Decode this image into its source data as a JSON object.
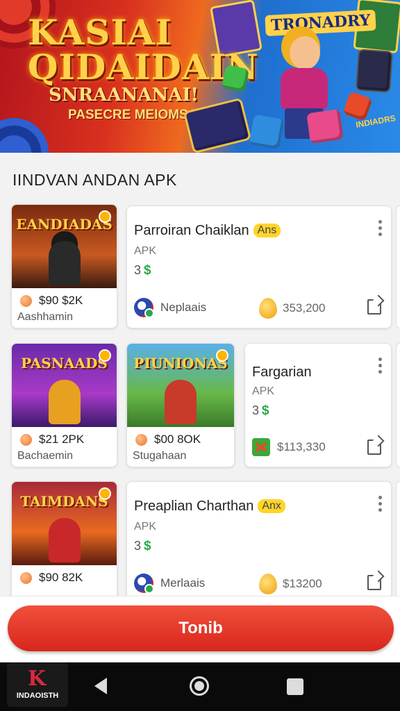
{
  "banner": {
    "title": "KASIAI QIDAIDAIN",
    "subtitle": "SNRAANANAI!",
    "tagline": "PASECRE MEIOMSAI",
    "brand": "TRONADRY",
    "corner_tag": "INDIADRS"
  },
  "section": {
    "title": "IINDVAN ANDAN APK"
  },
  "row1": {
    "small": {
      "thumb_title": "EANDIADAS",
      "price": "$90 $2K",
      "name": "Aashhamin"
    },
    "wide": {
      "title": "Parroiran Chaiklan",
      "badge": "Ans",
      "type": "APK",
      "rating": "3",
      "rating_symbol": "$",
      "developer": "Neplaais",
      "count": "353,200"
    }
  },
  "row2": {
    "small_a": {
      "thumb_title": "PASNAADS",
      "price": "$21 2PK",
      "name": "Bachaemin"
    },
    "small_b": {
      "thumb_title": "PIUNIONAS",
      "price": "$00 8OK",
      "name": "Stugahaan"
    },
    "wide": {
      "title": "Fargarian",
      "type": "APK",
      "rating": "3",
      "rating_symbol": "$",
      "count": "$113,330"
    }
  },
  "row3": {
    "small": {
      "thumb_title": "TAIMDANS",
      "price": "$90 82K"
    },
    "wide": {
      "title": "Preaplian Charthan",
      "badge": "Anx",
      "type": "APK",
      "rating": "3",
      "rating_symbol": "$",
      "developer": "Merlaais",
      "count": "$13200"
    }
  },
  "cta": {
    "label": "Tonib"
  },
  "app": {
    "logo_letter": "K",
    "logo_name": "INDAOISTH"
  },
  "colors": {
    "accent": "#d8261c",
    "badge": "#ffd52a",
    "rating_green": "#2aa84a"
  },
  "icons": [
    "coin-icon",
    "avatar-icon",
    "droplet-icon",
    "share-icon",
    "more-vert-icon",
    "back-icon",
    "home-icon",
    "recents-icon"
  ]
}
